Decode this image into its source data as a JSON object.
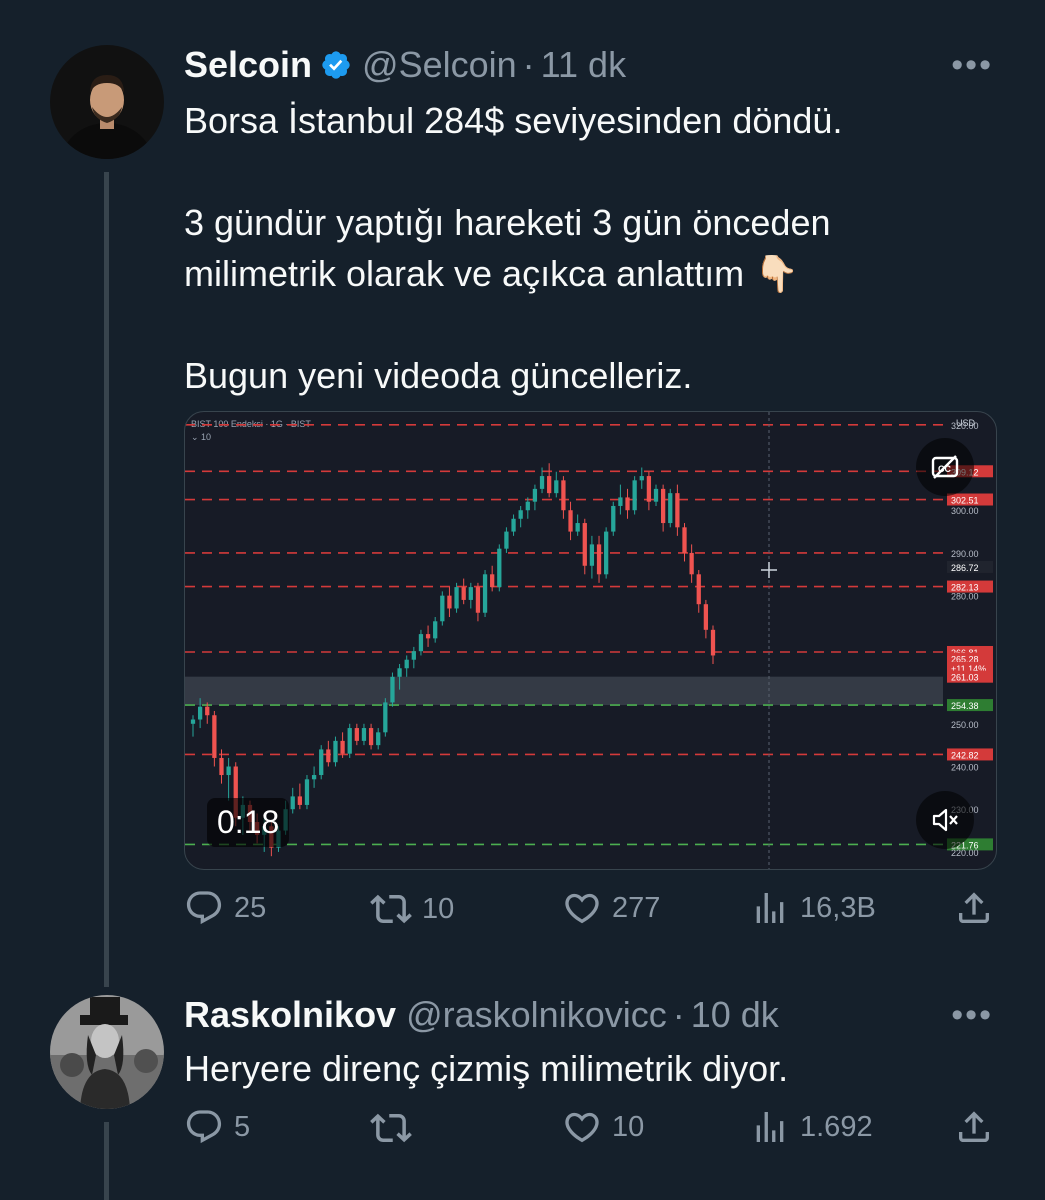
{
  "tweet1": {
    "name": "Selcoin",
    "handle": "@Selcoin",
    "separator": "·",
    "time": "11 dk",
    "more": "•••",
    "text": "Borsa İstanbul 284$ seviyesinden döndü.\n\n3 gündür yaptığı hareketi 3 gün önceden\nmilimetrik olarak ve açıkca anlattım 👇🏻\n\nBugun yeni videoda güncelleriz.",
    "video": {
      "timecode": "0:18",
      "chart_title": "BIST 100 Endeksi · 1G · BIST",
      "chart_subtitle": "⌄ 10",
      "currency": "USD"
    },
    "stats": {
      "replies": "25",
      "retweets": "10",
      "likes": "277",
      "views": "16,3B"
    }
  },
  "tweet2": {
    "name": "Raskolnikov",
    "handle": "@raskolnikovicc",
    "separator": "·",
    "time": "10 dk",
    "more": "•••",
    "text": "Heryere direnç çizmiş milimetrik diyor.",
    "stats": {
      "replies": "5",
      "retweets": "",
      "likes": "10",
      "views": "1.692"
    }
  },
  "chart_data": {
    "type": "candlestick",
    "currency": "USD",
    "y_ticks": [
      "320.00",
      "309.12",
      "302.51",
      "300.00",
      "290.00",
      "286.72",
      "282.13",
      "280.00",
      "266.81",
      "265.28",
      "+11.14%",
      "261.03",
      "254.38",
      "250.00",
      "242.82",
      "240.00",
      "230.00",
      "221.76",
      "220.00"
    ],
    "red_levels": [
      320,
      309.12,
      302.51,
      290,
      282.13,
      266.81,
      242.82
    ],
    "green_levels": [
      254.38,
      221.76
    ],
    "zone": [
      254.38,
      261.03
    ],
    "ylim": [
      216,
      323
    ],
    "candles": [
      [
        250,
        252,
        247,
        251
      ],
      [
        251,
        256,
        249,
        254
      ],
      [
        254,
        255,
        250,
        252
      ],
      [
        252,
        253,
        240,
        242
      ],
      [
        242,
        244,
        236,
        238
      ],
      [
        238,
        242,
        232,
        240
      ],
      [
        240,
        241,
        226,
        228
      ],
      [
        228,
        233,
        224,
        231
      ],
      [
        231,
        232,
        225,
        227
      ],
      [
        227,
        229,
        222,
        224
      ],
      [
        224,
        228,
        220,
        226
      ],
      [
        226,
        227,
        219,
        221
      ],
      [
        221,
        226,
        220,
        225
      ],
      [
        225,
        232,
        224,
        230
      ],
      [
        230,
        235,
        229,
        233
      ],
      [
        233,
        236,
        230,
        231
      ],
      [
        231,
        238,
        230,
        237
      ],
      [
        237,
        240,
        235,
        238
      ],
      [
        238,
        245,
        237,
        244
      ],
      [
        244,
        246,
        240,
        241
      ],
      [
        241,
        247,
        240,
        246
      ],
      [
        246,
        248,
        242,
        243
      ],
      [
        243,
        250,
        242,
        249
      ],
      [
        249,
        250,
        245,
        246
      ],
      [
        246,
        250,
        245,
        249
      ],
      [
        249,
        250,
        244,
        245
      ],
      [
        245,
        249,
        244,
        248
      ],
      [
        248,
        256,
        247,
        255
      ],
      [
        255,
        262,
        254,
        261
      ],
      [
        261,
        264,
        258,
        263
      ],
      [
        263,
        266,
        261,
        265
      ],
      [
        265,
        268,
        263,
        267
      ],
      [
        267,
        272,
        266,
        271
      ],
      [
        271,
        273,
        268,
        270
      ],
      [
        270,
        275,
        269,
        274
      ],
      [
        274,
        281,
        273,
        280
      ],
      [
        280,
        282,
        275,
        277
      ],
      [
        277,
        283,
        276,
        282
      ],
      [
        282,
        284,
        278,
        279
      ],
      [
        279,
        283,
        277,
        282
      ],
      [
        282,
        283,
        274,
        276
      ],
      [
        276,
        286,
        275,
        285
      ],
      [
        285,
        287,
        281,
        282
      ],
      [
        282,
        292,
        281,
        291
      ],
      [
        291,
        296,
        290,
        295
      ],
      [
        295,
        299,
        294,
        298
      ],
      [
        298,
        301,
        296,
        300
      ],
      [
        300,
        303,
        298,
        302
      ],
      [
        302,
        306,
        300,
        305
      ],
      [
        305,
        310,
        304,
        308
      ],
      [
        308,
        311,
        303,
        304
      ],
      [
        304,
        309,
        303,
        307
      ],
      [
        307,
        308,
        298,
        300
      ],
      [
        300,
        302,
        293,
        295
      ],
      [
        295,
        299,
        294,
        297
      ],
      [
        297,
        298,
        285,
        287
      ],
      [
        287,
        294,
        284,
        292
      ],
      [
        292,
        294,
        283,
        285
      ],
      [
        285,
        296,
        284,
        295
      ],
      [
        295,
        302,
        294,
        301
      ],
      [
        301,
        306,
        299,
        303
      ],
      [
        303,
        305,
        298,
        300
      ],
      [
        300,
        308,
        299,
        307
      ],
      [
        307,
        310,
        305,
        308
      ],
      [
        308,
        309,
        300,
        302
      ],
      [
        302,
        306,
        301,
        305
      ],
      [
        305,
        306,
        295,
        297
      ],
      [
        297,
        305,
        296,
        304
      ],
      [
        304,
        306,
        294,
        296
      ],
      [
        296,
        297,
        288,
        290
      ],
      [
        290,
        292,
        283,
        285
      ],
      [
        285,
        286,
        276,
        278
      ],
      [
        278,
        279,
        270,
        272
      ],
      [
        272,
        273,
        264,
        266
      ]
    ]
  }
}
